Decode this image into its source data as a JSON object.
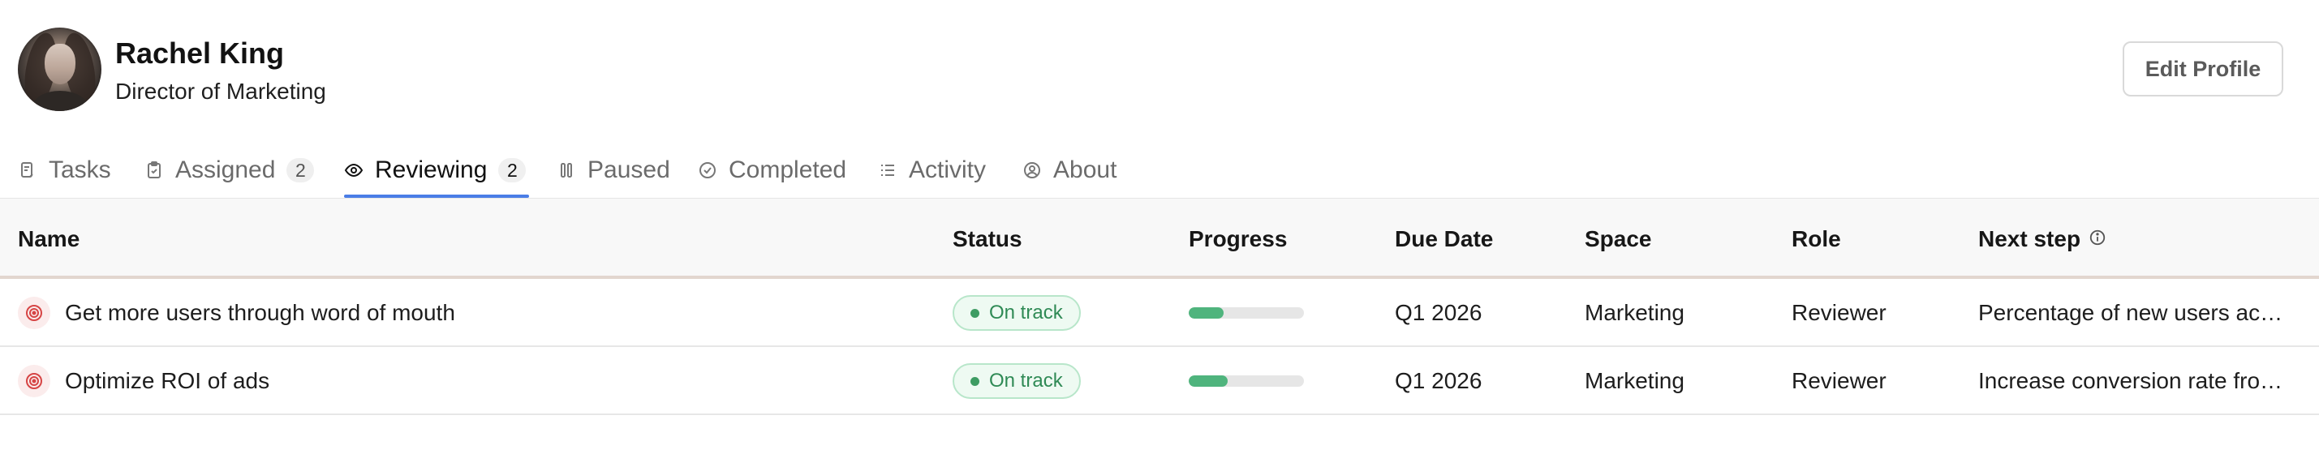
{
  "profile": {
    "name": "Rachel King",
    "title": "Director of Marketing",
    "edit_label": "Edit Profile"
  },
  "tabs": [
    {
      "label": "Tasks",
      "icon": "tasks-icon",
      "count": null
    },
    {
      "label": "Assigned",
      "icon": "clipboard-check-icon",
      "count": "2"
    },
    {
      "label": "Reviewing",
      "icon": "eye-icon",
      "count": "2",
      "active": true
    },
    {
      "label": "Paused",
      "icon": "pause-icon",
      "count": null
    },
    {
      "label": "Completed",
      "icon": "check-circle-icon",
      "count": null
    },
    {
      "label": "Activity",
      "icon": "list-icon",
      "count": null
    },
    {
      "label": "About",
      "icon": "user-circle-icon",
      "count": null
    }
  ],
  "table": {
    "columns": [
      "Name",
      "Status",
      "Progress",
      "Due Date",
      "Space",
      "Role",
      "Next step"
    ],
    "rows": [
      {
        "name": "Get more users through word of mouth",
        "status": "On track",
        "progress": 0.3,
        "due_date": "Q1 2026",
        "space": "Marketing",
        "role": "Reviewer",
        "next_step": "Percentage of new users ac…"
      },
      {
        "name": "Optimize ROI of ads",
        "status": "On track",
        "progress": 0.34,
        "due_date": "Q1 2026",
        "space": "Marketing",
        "role": "Reviewer",
        "next_step": "Increase conversion rate fro…"
      }
    ]
  },
  "colors": {
    "accent": "#4a7de6",
    "status_green": "#2f8a55",
    "progress_fill": "#4fb47d"
  }
}
